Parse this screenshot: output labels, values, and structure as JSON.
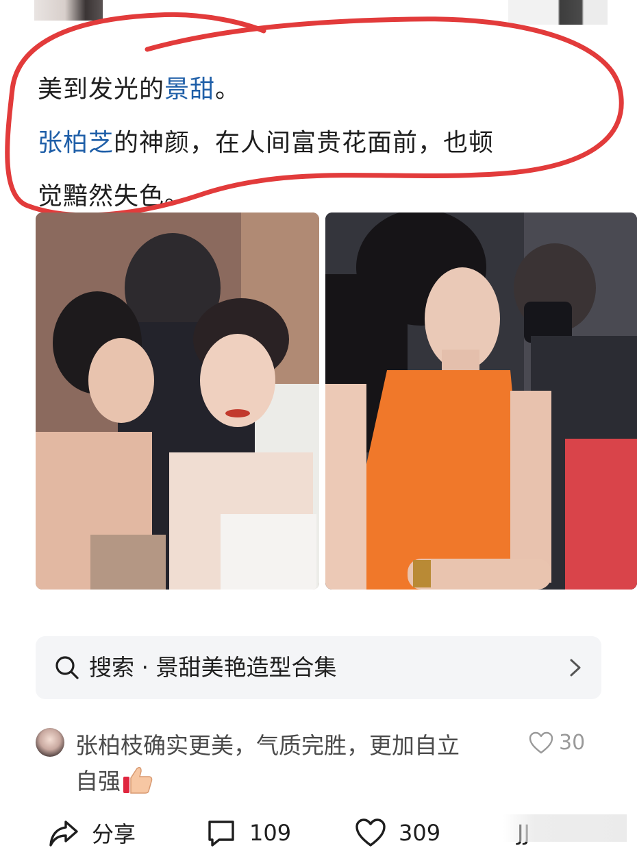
{
  "post": {
    "line1_prefix": "美到发光的",
    "line1_link": "景甜",
    "line1_suffix": "。",
    "line2_link": "张柏芝",
    "line2_suffix": "的神颜，在人间富贵花面前，也顿",
    "line3": "觉黯然失色。"
  },
  "search": {
    "label": "搜索 · 景甜美艳造型合集",
    "icon": "search-icon",
    "chevron": "chevron-right-icon"
  },
  "comment": {
    "text_line1": "张柏枝确实更美，气质完胜，更加自立",
    "text_line2": "自强",
    "emoji": "thumbs-up",
    "like_count": "30"
  },
  "actions": {
    "share_label": "分享",
    "comment_count": "109",
    "like_count": "309",
    "fav_partial": "JJ"
  },
  "colors": {
    "link": "#1f5fa8",
    "annotation_red": "#e23b3b",
    "search_bg": "#f4f5f7",
    "orange_dress": "#f0782a"
  }
}
